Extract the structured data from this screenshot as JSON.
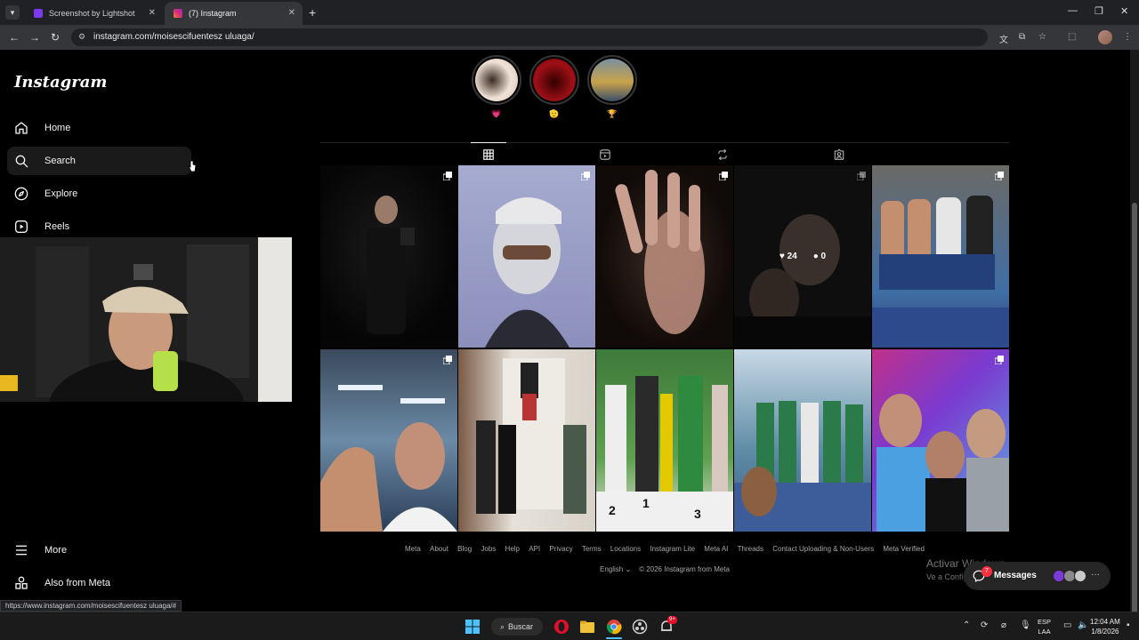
{
  "browser": {
    "tabs": [
      {
        "title": "Screenshot by Lightshot",
        "favicon_color": "#7c3aed",
        "active": false
      },
      {
        "title": "(7) Instagram",
        "favicon_color": "#e1306c",
        "active": true
      }
    ],
    "url": "instagram.com/moisescifuentesz uluaga/"
  },
  "sidebar": {
    "logo": "Instagram",
    "items": [
      {
        "label": "Home",
        "icon": "home-icon"
      },
      {
        "label": "Search",
        "icon": "search-icon"
      },
      {
        "label": "Explore",
        "icon": "compass-icon"
      },
      {
        "label": "Reels",
        "icon": "reels-icon"
      }
    ],
    "more": "More",
    "also_from_meta": "Also from Meta"
  },
  "stories": [
    {
      "emoji": "💗",
      "color": "#f0e2d6"
    },
    {
      "emoji": "🫡",
      "color": "#a01018"
    },
    {
      "emoji": "🏆",
      "color": "#7a8fa0"
    }
  ],
  "profile_tabs": [
    "grid-icon",
    "reels-icon",
    "reposts-icon",
    "tagged-icon"
  ],
  "posts": [
    {
      "multi": true,
      "colors": [
        "#0a0a0a",
        "#1a1a1a"
      ]
    },
    {
      "multi": true,
      "colors": [
        "#9aa0c8",
        "#3a3e5a"
      ]
    },
    {
      "multi": true,
      "colors": [
        "#c99a82",
        "#2a1d18"
      ]
    },
    {
      "multi": true,
      "colors": [
        "#1a1a1a",
        "#2c2c2c"
      ],
      "likes": "24",
      "comments": "0"
    },
    {
      "multi": true,
      "colors": [
        "#3f6ea5",
        "#2d3f72"
      ]
    },
    {
      "multi": true,
      "colors": [
        "#8fa9c3",
        "#d8c4aa"
      ]
    },
    {
      "multi": false,
      "colors": [
        "#e2e0d8",
        "#3b2f2a"
      ]
    },
    {
      "multi": false,
      "colors": [
        "#4f9a45",
        "#e2d94a"
      ]
    },
    {
      "multi": false,
      "colors": [
        "#5f8da6",
        "#2b7a4a"
      ]
    },
    {
      "multi": true,
      "colors": [
        "#c0308a",
        "#5ab0e0"
      ]
    }
  ],
  "footer": {
    "links": [
      "Meta",
      "About",
      "Blog",
      "Jobs",
      "Help",
      "API",
      "Privacy",
      "Terms",
      "Locations",
      "Instagram Lite",
      "Meta AI",
      "Threads",
      "Contact Uploading & Non-Users",
      "Meta Verified"
    ],
    "language": "English",
    "copyright": "© 2026 Instagram from Meta"
  },
  "watermark": {
    "title": "Activar Windows",
    "subtitle": "Ve a Configuración para activar Windows."
  },
  "messages": {
    "label": "Messages",
    "badge": "7"
  },
  "status_url": "https://www.instagram.com/moisescifuentesz uluaga/#",
  "taskbar": {
    "search": "Buscar",
    "lang_line1": "ESP",
    "lang_line2": "LAA",
    "time": "12:04 AM",
    "date": "1/8/2026",
    "notif_badge": "9+"
  }
}
